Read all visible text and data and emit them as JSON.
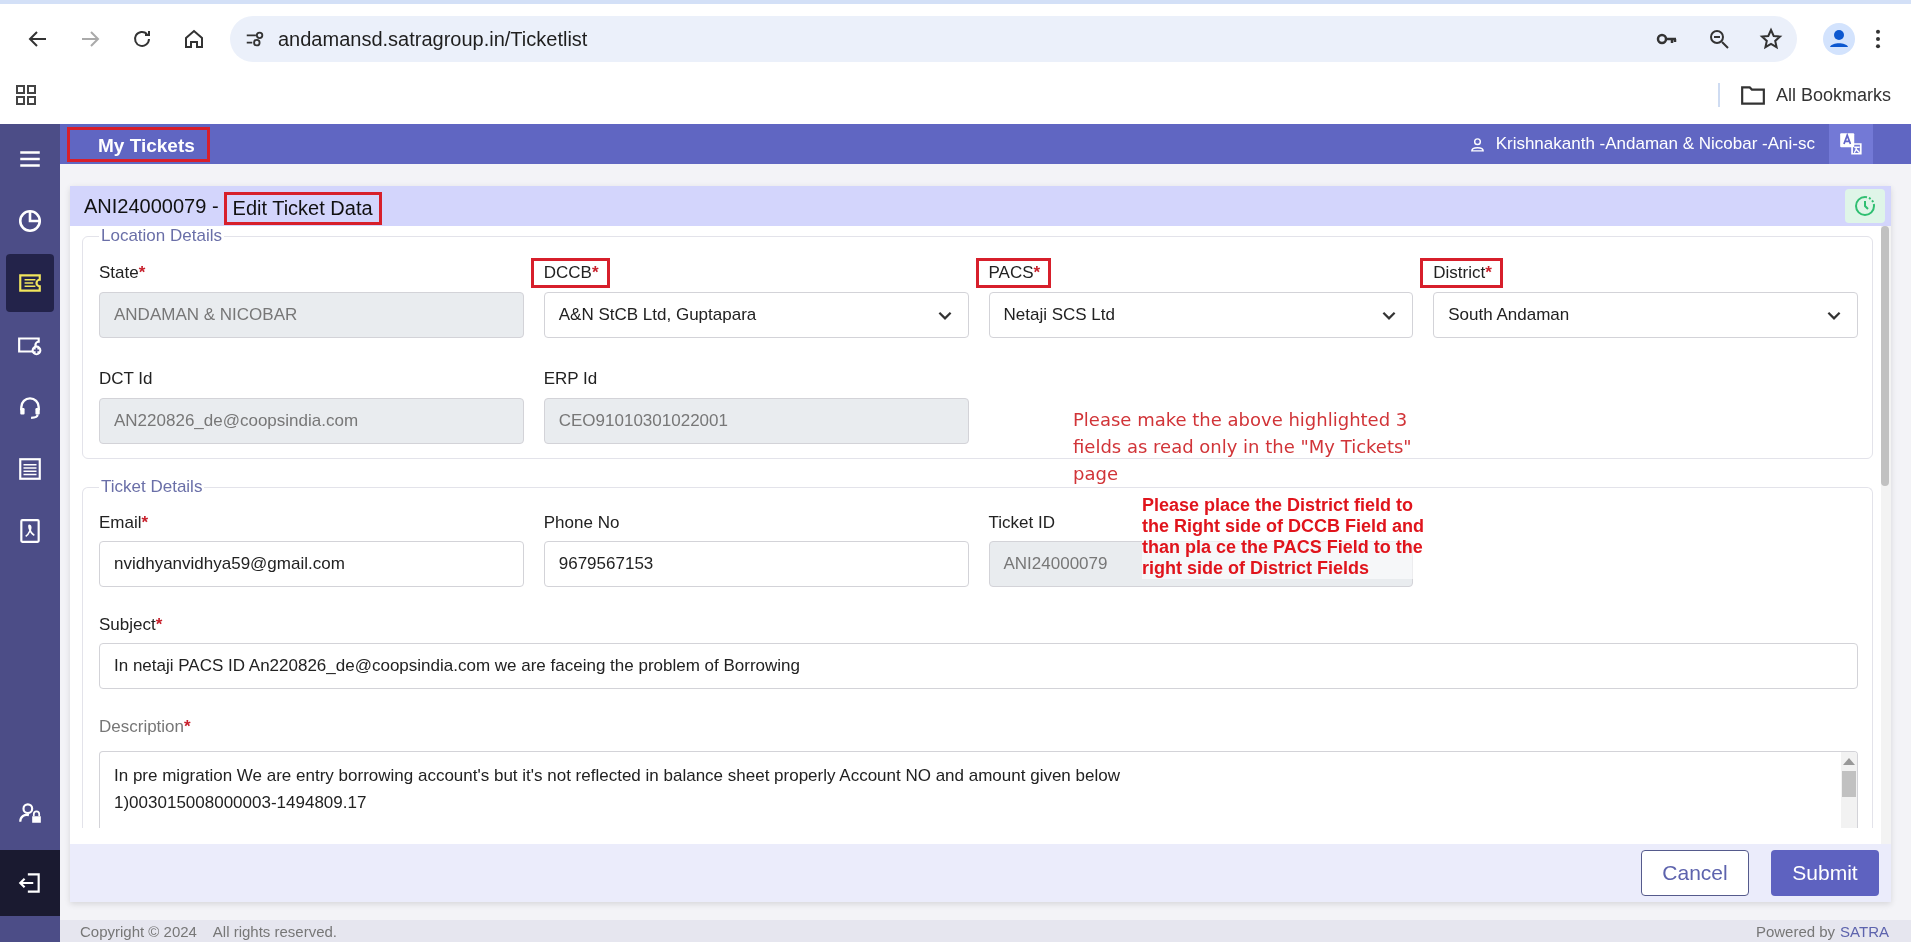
{
  "browser": {
    "url": "andamansd.satragroup.in/Ticketlist",
    "forward_disabled": true,
    "bookmarks_label": "All Bookmarks"
  },
  "header": {
    "title": "My Tickets",
    "title_highlighted": true,
    "user": "Krishnakanth -Andaman & Nicobar -Ani-sc"
  },
  "sidebar": {
    "items": [
      {
        "kind": "menu",
        "selected": false
      },
      {
        "kind": "chart",
        "selected": false
      },
      {
        "kind": "ticket",
        "selected": true
      },
      {
        "kind": "ticket-add",
        "selected": false
      },
      {
        "kind": "headset",
        "selected": false
      },
      {
        "kind": "list",
        "selected": false
      },
      {
        "kind": "pdf",
        "selected": false
      }
    ],
    "bottom_items": [
      {
        "kind": "user-lock",
        "selected": false
      },
      {
        "kind": "logout",
        "selected": true
      }
    ]
  },
  "ticket": {
    "id": "ANI24000079 -",
    "title": "Edit Ticket Data",
    "title_highlighted": true
  },
  "location_details": {
    "legend": "Location Details",
    "fields": [
      {
        "label": "State",
        "required_mark": "*",
        "value": "ANDAMAN & NICOBAR",
        "kind": "readonly",
        "highlighted": false
      },
      {
        "label": "DCCB",
        "required_mark": "*",
        "value": "A&N StCB Ltd, Guptapara",
        "kind": "select",
        "highlighted": true
      },
      {
        "label": "PACS",
        "required_mark": "*",
        "value": "Netaji SCS Ltd",
        "kind": "select",
        "highlighted": true
      },
      {
        "label": "District",
        "required_mark": "*",
        "value": "South Andaman",
        "kind": "select",
        "highlighted": true
      },
      {
        "label": "DCT Id",
        "value": "AN220826_de@coopsindia.com",
        "kind": "readonly",
        "highlighted": false
      },
      {
        "label": "ERP Id",
        "value": "CEO91010301022001",
        "kind": "readonly",
        "highlighted": false
      }
    ]
  },
  "ticket_details": {
    "legend": "Ticket Details",
    "fields": [
      {
        "label": "Email",
        "required_mark": "*",
        "value": "nvidhyanvidhya59@gmail.com",
        "kind": "text"
      },
      {
        "label": "Phone No",
        "value": "9679567153",
        "kind": "text"
      },
      {
        "label": "Ticket ID",
        "value": "ANI24000079",
        "kind": "readonly"
      }
    ],
    "subject": {
      "label": "Subject",
      "required_mark": "*",
      "value": "In netaji PACS ID An220826_de@coopsindia.com  we are faceing  the problem of Borrowing"
    },
    "description": {
      "label": "Description",
      "required_mark": "*",
      "lines": [
        "In pre migration We are  entry borrowing account's but it's not reflected in balance  sheet properly  Account NO  and amount given below",
        "1)003015008000003-1494809.17"
      ]
    }
  },
  "annotations": [
    {
      "kind": "note",
      "text": "Please make the above highlighted 3  fields as read only in the \"My Tickets\" page"
    },
    {
      "kind": "bold-note",
      "text": "Please place the District field to the Right side of DCCB Field and than pla ce the PACS Field to the right side of District Fields"
    }
  ],
  "buttons": [
    {
      "label": "Cancel",
      "kind": "secondary"
    },
    {
      "label": "Submit",
      "kind": "primary"
    }
  ],
  "footer": {
    "copyright": "Copyright © 2024    All rights reserved.",
    "powered": "Powered by",
    "brand": "SATRA"
  }
}
